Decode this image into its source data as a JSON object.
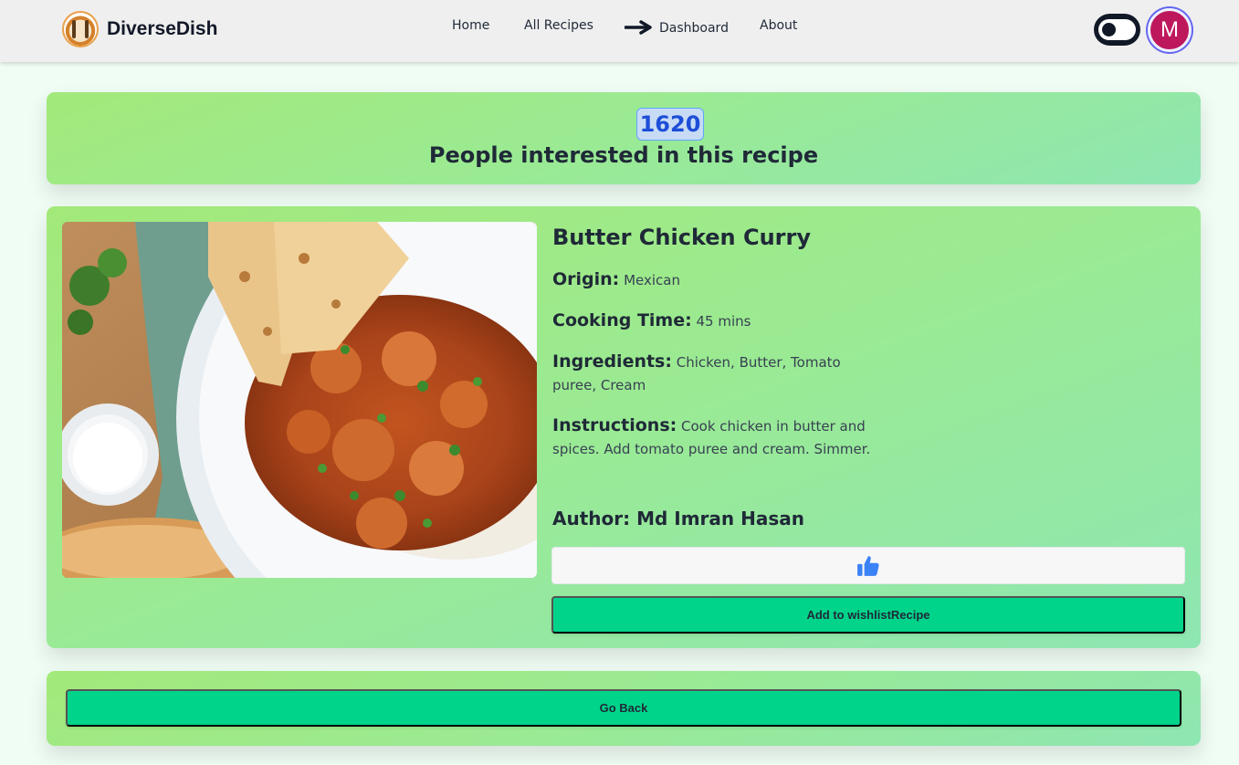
{
  "navbar": {
    "brand": "DiverseDish",
    "links": {
      "home": "Home",
      "all_recipes": "All Recipes",
      "dashboard": "Dashboard",
      "about": "About"
    },
    "avatar_initial": "M"
  },
  "interest": {
    "count": "1620",
    "text": "People interested in this recipe"
  },
  "recipe": {
    "title": "Butter Chicken Curry",
    "origin_label": "Origin:",
    "origin": "Mexican",
    "cooking_time_label": "Cooking Time:",
    "cooking_time": "45 mins",
    "ingredients_label": "Ingredients:",
    "ingredients": "Chicken, Butter, Tomato puree, Cream",
    "instructions_label": "Instructions:",
    "instructions": "Cook chicken in butter and spices. Add tomato puree and cream. Simmer.",
    "author": "Author: Md Imran Hasan"
  },
  "actions": {
    "like_icon": "thumbs-up-icon",
    "wishlist_label": "Add to wishlistRecipe",
    "back_label": "Go Back"
  },
  "colors": {
    "card_gradient_start": "#a3e97a",
    "card_gradient_end": "#8ee6b2",
    "button_green": "#00d48a",
    "badge_blue": "#1d4ed8",
    "like_blue": "#3b82f6",
    "avatar": "#be185d"
  }
}
